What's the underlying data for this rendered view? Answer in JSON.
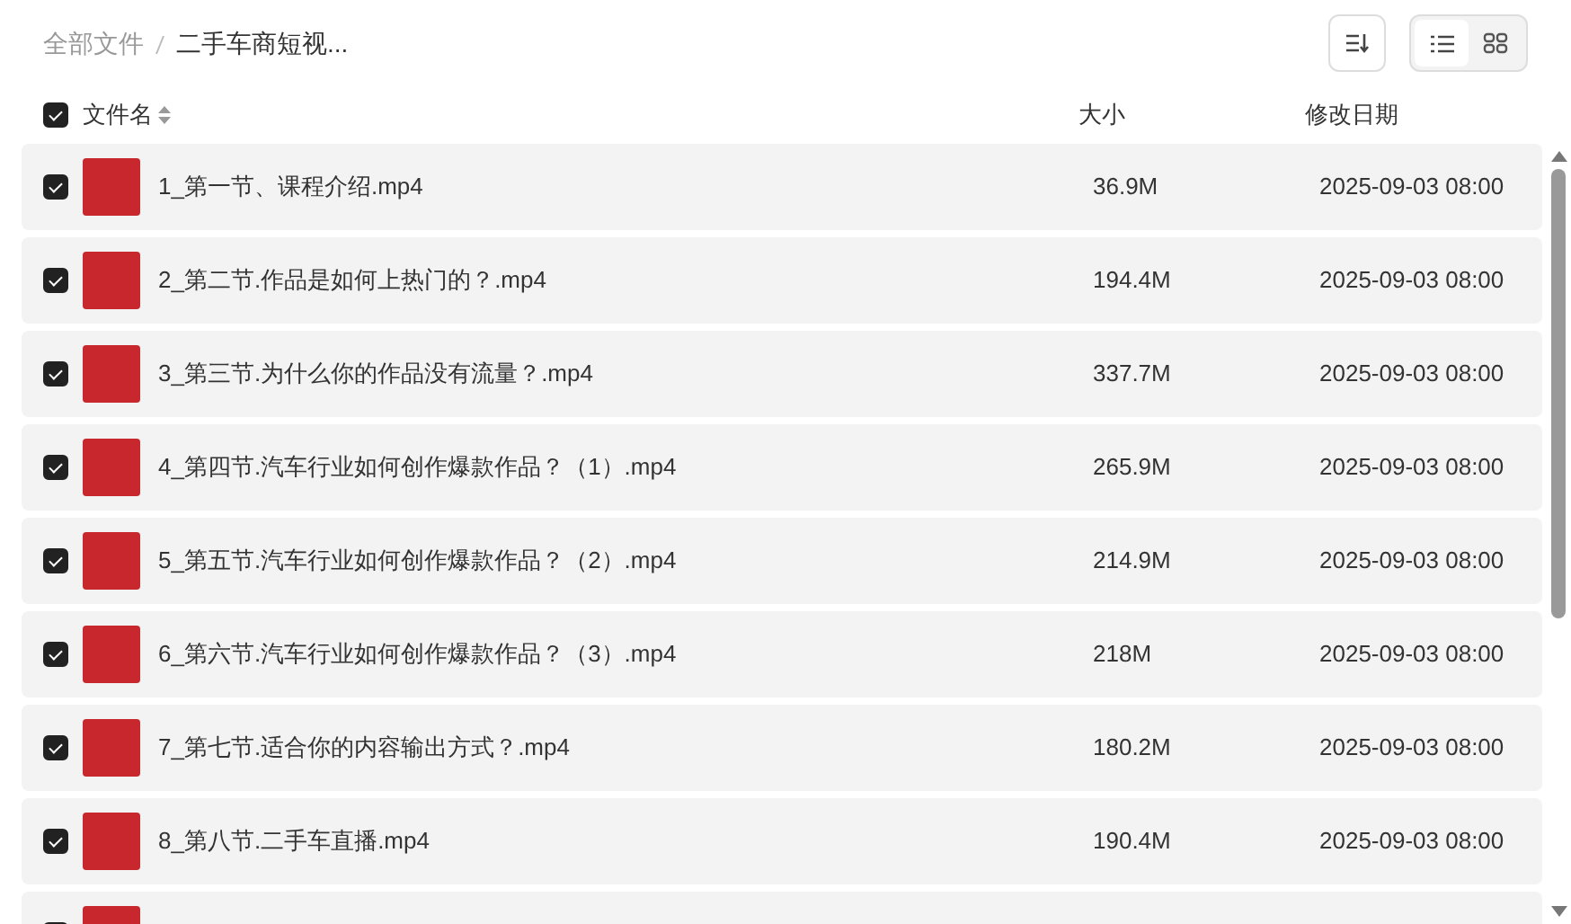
{
  "breadcrumb": [
    {
      "label": "全部文件",
      "current": false
    },
    {
      "label": "二手车商短视...",
      "current": true
    }
  ],
  "view_toggle": [
    {
      "kind": "list",
      "selected": true
    },
    {
      "kind": "grid",
      "selected": false
    }
  ],
  "header": {
    "checked": true,
    "columns": [
      "文件名",
      "大小",
      "修改日期"
    ]
  },
  "rows": [
    {
      "checked": true,
      "name": "1_第一节、课程介绍.mp4",
      "size": "36.9M",
      "date": "2025-09-03 08:00"
    },
    {
      "checked": true,
      "name": "2_第二节.作品是如何上热门的？.mp4",
      "size": "194.4M",
      "date": "2025-09-03 08:00"
    },
    {
      "checked": true,
      "name": "3_第三节.为什么你的作品没有流量？.mp4",
      "size": "337.7M",
      "date": "2025-09-03 08:00"
    },
    {
      "checked": true,
      "name": "4_第四节.汽车行业如何创作爆款作品？（1）.mp4",
      "size": "265.9M",
      "date": "2025-09-03 08:00"
    },
    {
      "checked": true,
      "name": "5_第五节.汽车行业如何创作爆款作品？（2）.mp4",
      "size": "214.9M",
      "date": "2025-09-03 08:00"
    },
    {
      "checked": true,
      "name": "6_第六节.汽车行业如何创作爆款作品？（3）.mp4",
      "size": "218M",
      "date": "2025-09-03 08:00"
    },
    {
      "checked": true,
      "name": "7_第七节.适合你的内容输出方式？.mp4",
      "size": "180.2M",
      "date": "2025-09-03 08:00"
    },
    {
      "checked": true,
      "name": "8_第八节.二手车直播.mp4",
      "size": "190.4M",
      "date": "2025-09-03 08:00"
    },
    {
      "checked": true
    }
  ]
}
